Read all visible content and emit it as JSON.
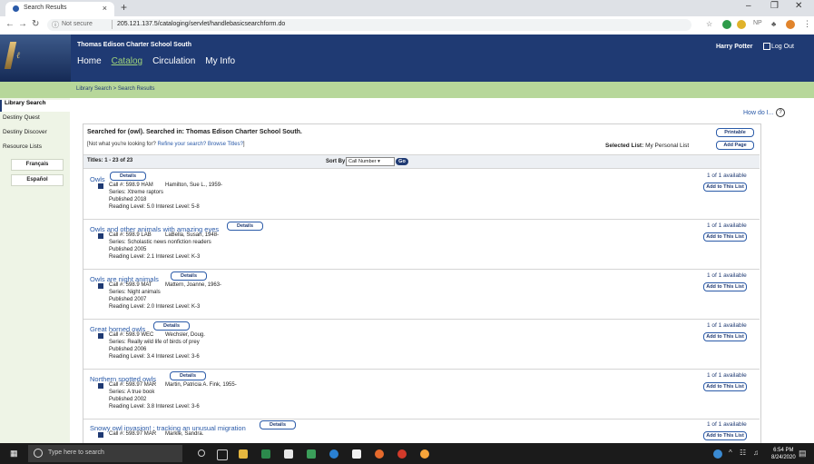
{
  "browser": {
    "tab_title": "Search Results",
    "tab_close": "×",
    "new_tab": "+",
    "not_secure": "Not secure",
    "url": "205.121.137.5/cataloging/servlet/handlebasicsearchform.do",
    "ext_label": "NP"
  },
  "header": {
    "school_name": "Thomas Edison Charter School South",
    "nav": [
      "Home",
      "Catalog",
      "Circulation",
      "My Info"
    ],
    "active_nav": "Catalog",
    "user": "Harry Potter",
    "logout": "Log Out"
  },
  "breadcrumb": "Library Search > Search Results",
  "sidebar": {
    "items": [
      "Library Search",
      "Destiny Quest",
      "Destiny Discover",
      "Resource Lists"
    ],
    "languages": [
      "Français",
      "Español"
    ]
  },
  "main": {
    "how_do_i": "How do I...",
    "searched_for": "Searched for (owl). Searched in: Thomas Edison Charter School South.",
    "not_what_prefix": "[Not what you're looking for? ",
    "refine_link": "Refine your search? Browse Titles?",
    "not_what_suffix": "]",
    "printable": "Printable",
    "add_page": "Add Page",
    "selected_list_label": "Selected List:",
    "selected_list_value": "My Personal List",
    "titles_count": "Titles: 1 - 23 of 23",
    "sort_by": "Sort By",
    "sort_value": "Call Number",
    "go": "Go",
    "details_label": "Details",
    "add_to_list_label": "Add to This List",
    "results": [
      {
        "title": "Owls",
        "call": "Call #: 598.9 HAM",
        "author": "Hamilton, Sue L., 1959-",
        "series": "Series: Xtreme raptors",
        "published": "Published 2018",
        "reading": "Reading Level: 5.0  Interest Level: 5-8",
        "avail": "1 of 1 available"
      },
      {
        "title": "Owls and other animals with amazing eyes",
        "call": "Call #: 598.9 LAB",
        "author": "LaBella, Susan, 1948-",
        "series": "Series: Scholastic news nonfiction readers",
        "published": "Published 2005",
        "reading": "Reading Level: 2.1  Interest Level: K-3",
        "avail": "1 of 1 available"
      },
      {
        "title": "Owls are night animals",
        "call": "Call #: 598.9 MAT",
        "author": "Mattern, Joanne, 1963-",
        "series": "Series: Night animals",
        "published": "Published 2007",
        "reading": "Reading Level: 2.0  Interest Level: K-3",
        "avail": "1 of 1 available"
      },
      {
        "title": "Great horned owls",
        "call": "Call #: 598.9 WEC",
        "author": "Wechsler, Doug.",
        "series": "Series: Really wild life of birds of prey",
        "published": "Published 2006",
        "reading": "Reading Level: 3.4  Interest Level: 3-6",
        "avail": "1 of 1 available"
      },
      {
        "title": "Northern spotted owls",
        "call": "Call #: 598.97 MAR",
        "author": "Martin, Patricia A. Fink, 1955-",
        "series": "Series: A true book",
        "published": "Published 2002",
        "reading": "Reading Level: 3.8  Interest Level: 3-6",
        "avail": "1 of 1 available"
      },
      {
        "title": "Snowy owl invasion! : tracking an unusual migration",
        "call": "Call #: 598.97 MAR",
        "author": "Markle, Sandra.",
        "series": "",
        "published": "",
        "reading": "",
        "avail": "1 of 1 available"
      }
    ]
  },
  "taskbar": {
    "search_placeholder": "Type here to search",
    "time": "6:54 PM",
    "date": "8/24/2020"
  },
  "colors": {
    "header": "#1f3a73",
    "breadcrumb": "#b7d79a",
    "sidebar": "#eef4e6",
    "link": "#2a5aa8",
    "active_nav": "#9fd37a"
  }
}
